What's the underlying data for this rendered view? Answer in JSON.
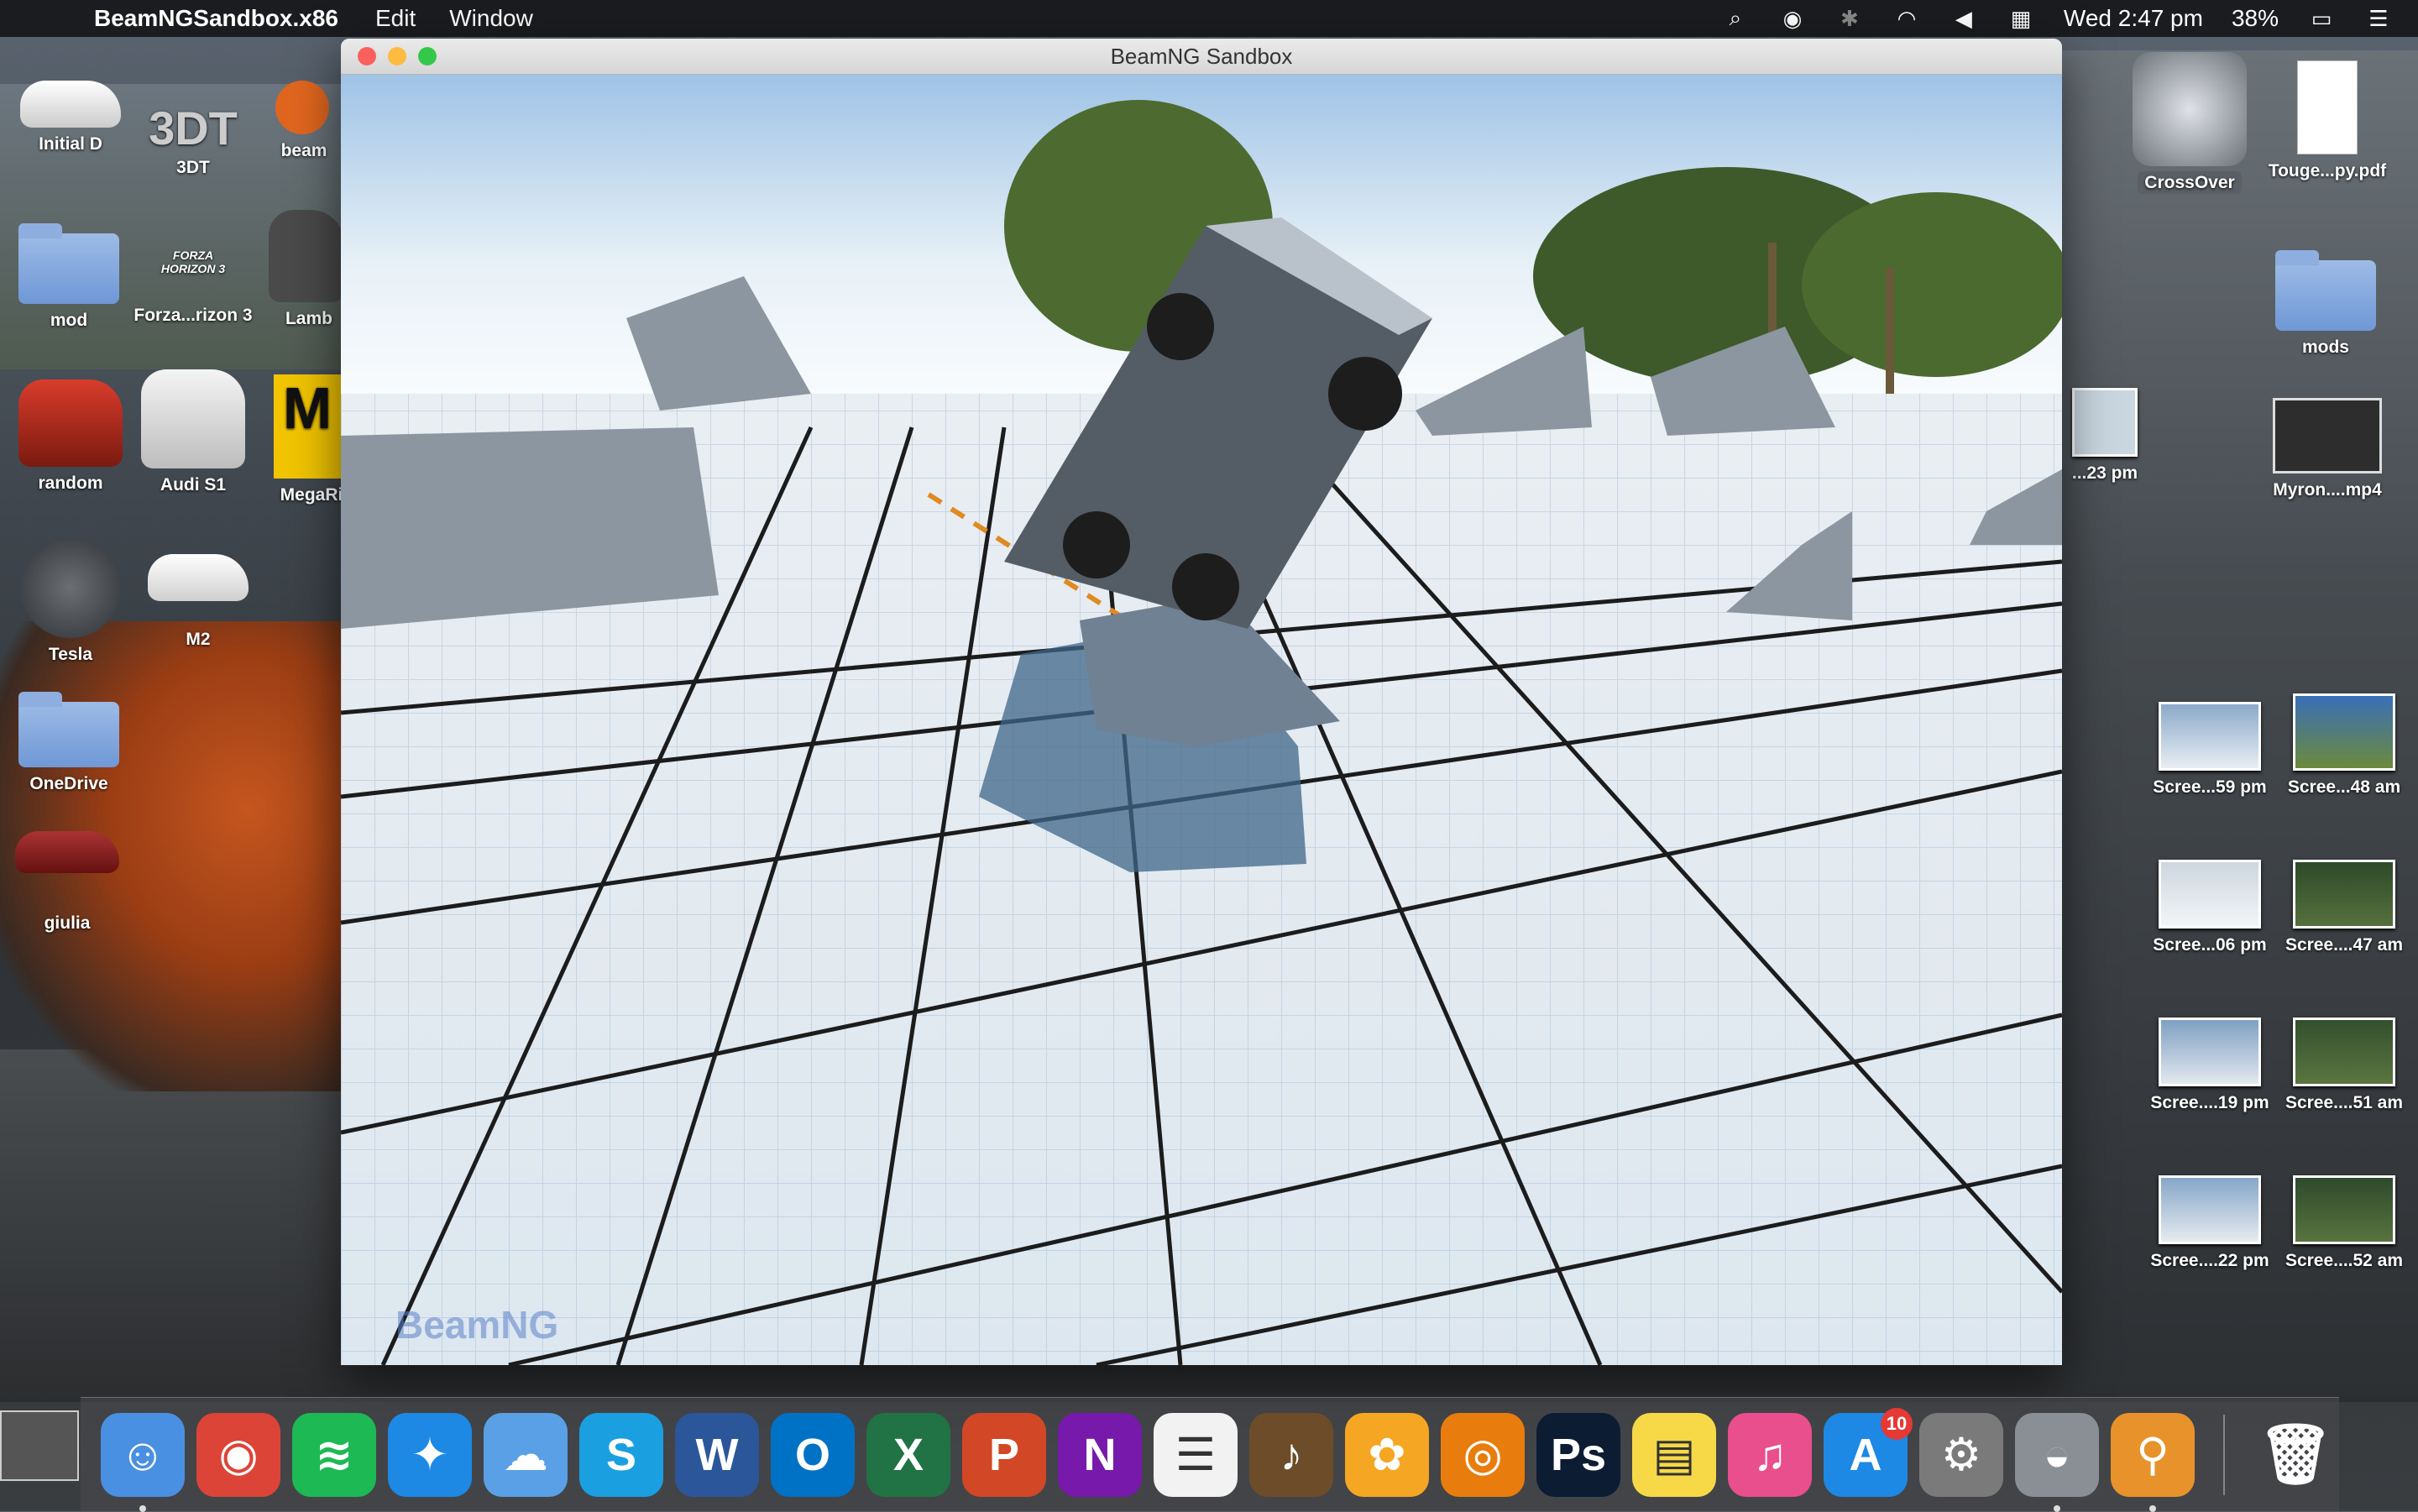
{
  "menubar": {
    "app_name": "BeamNGSandbox.x86",
    "menus": [
      "Edit",
      "Window"
    ],
    "clock": "Wed 2:47 pm",
    "battery": "38%"
  },
  "window": {
    "title": "BeamNG Sandbox",
    "watermark": "BeamNG"
  },
  "desktop_left": [
    {
      "label": "Initial D",
      "icon": "car-icon"
    },
    {
      "label": "3DT",
      "icon": "logo-icon",
      "logo_text": "3DT"
    },
    {
      "label": "beam",
      "icon": "app-icon"
    },
    {
      "label": "mod",
      "icon": "folder-icon"
    },
    {
      "label": "Forza...rizon 3",
      "icon": "logo-icon",
      "logo_text": "FORZA HORIZON 3"
    },
    {
      "label": "Lamb",
      "icon": "car-icon"
    },
    {
      "label": "random",
      "icon": "car-icon"
    },
    {
      "label": "Audi S1",
      "icon": "car-icon"
    },
    {
      "label": "MegaRi",
      "icon": "app-icon"
    },
    {
      "label": "Tesla",
      "icon": "car-icon"
    },
    {
      "label": "M2",
      "icon": "car-icon"
    },
    {
      "label": "OneDrive",
      "icon": "cloud-folder-icon"
    },
    {
      "label": "giulia",
      "icon": "car-icon"
    }
  ],
  "desktop_right": [
    {
      "label": "CrossOver",
      "icon": "crossover-icon"
    },
    {
      "label": "Touge...py.pdf",
      "icon": "pdf-icon"
    },
    {
      "label": "mods",
      "icon": "folder-icon"
    },
    {
      "label": "...23 pm",
      "icon": "screenshot-icon"
    },
    {
      "label": "Myron....mp4",
      "icon": "video-icon"
    },
    {
      "label": "Scree...59 pm",
      "icon": "screenshot-icon"
    },
    {
      "label": "Scree...48 am",
      "icon": "screenshot-icon"
    },
    {
      "label": "Scree...06 pm",
      "icon": "screenshot-icon"
    },
    {
      "label": "Scree....47 am",
      "icon": "screenshot-icon"
    },
    {
      "label": "Scree....19 pm",
      "icon": "screenshot-icon"
    },
    {
      "label": "Scree....51 am",
      "icon": "screenshot-icon"
    },
    {
      "label": "Scree....22 pm",
      "icon": "screenshot-icon"
    },
    {
      "label": "Scree....52 am",
      "icon": "screenshot-icon"
    }
  ],
  "dock": {
    "apps": [
      {
        "name": "Finder",
        "glyph": "☺",
        "color": "#4a90e2"
      },
      {
        "name": "Chrome",
        "glyph": "◉",
        "color": "#db4437"
      },
      {
        "name": "Spotify",
        "glyph": "≋",
        "color": "#1db954"
      },
      {
        "name": "Safari",
        "glyph": "✦",
        "color": "#1e88e5"
      },
      {
        "name": "iCloud",
        "glyph": "☁",
        "color": "#5aa0e6"
      },
      {
        "name": "Skype",
        "glyph": "S",
        "color": "#1a9fe0"
      },
      {
        "name": "Word",
        "glyph": "W",
        "color": "#2b579a"
      },
      {
        "name": "Outlook",
        "glyph": "O",
        "color": "#0072c6"
      },
      {
        "name": "Excel",
        "glyph": "X",
        "color": "#217346"
      },
      {
        "name": "PowerPoint",
        "glyph": "P",
        "color": "#d24726"
      },
      {
        "name": "OneNote",
        "glyph": "N",
        "color": "#7719aa"
      },
      {
        "name": "Reminders",
        "glyph": "☰",
        "color": "#f2f2f2"
      },
      {
        "name": "GarageBand",
        "glyph": "♪",
        "color": "#6d4c2a"
      },
      {
        "name": "Photos",
        "glyph": "✿",
        "color": "#f5a623"
      },
      {
        "name": "Blender",
        "glyph": "◎",
        "color": "#e87d0d"
      },
      {
        "name": "Photoshop",
        "glyph": "Ps",
        "color": "#0b1c33"
      },
      {
        "name": "Notes",
        "glyph": "▤",
        "color": "#f7d948"
      },
      {
        "name": "iTunes",
        "glyph": "♫",
        "color": "#e84f8c"
      },
      {
        "name": "App Store",
        "glyph": "A",
        "color": "#1e88e5",
        "badge": "10"
      },
      {
        "name": "System Preferences",
        "glyph": "⚙",
        "color": "#7a7a7a"
      },
      {
        "name": "CrossOver",
        "glyph": "◒",
        "color": "#8a8f95"
      },
      {
        "name": "BeamNG",
        "glyph": "⚲",
        "color": "#e8922b"
      }
    ],
    "trash": {
      "name": "Trash",
      "glyph": "🗑"
    }
  }
}
